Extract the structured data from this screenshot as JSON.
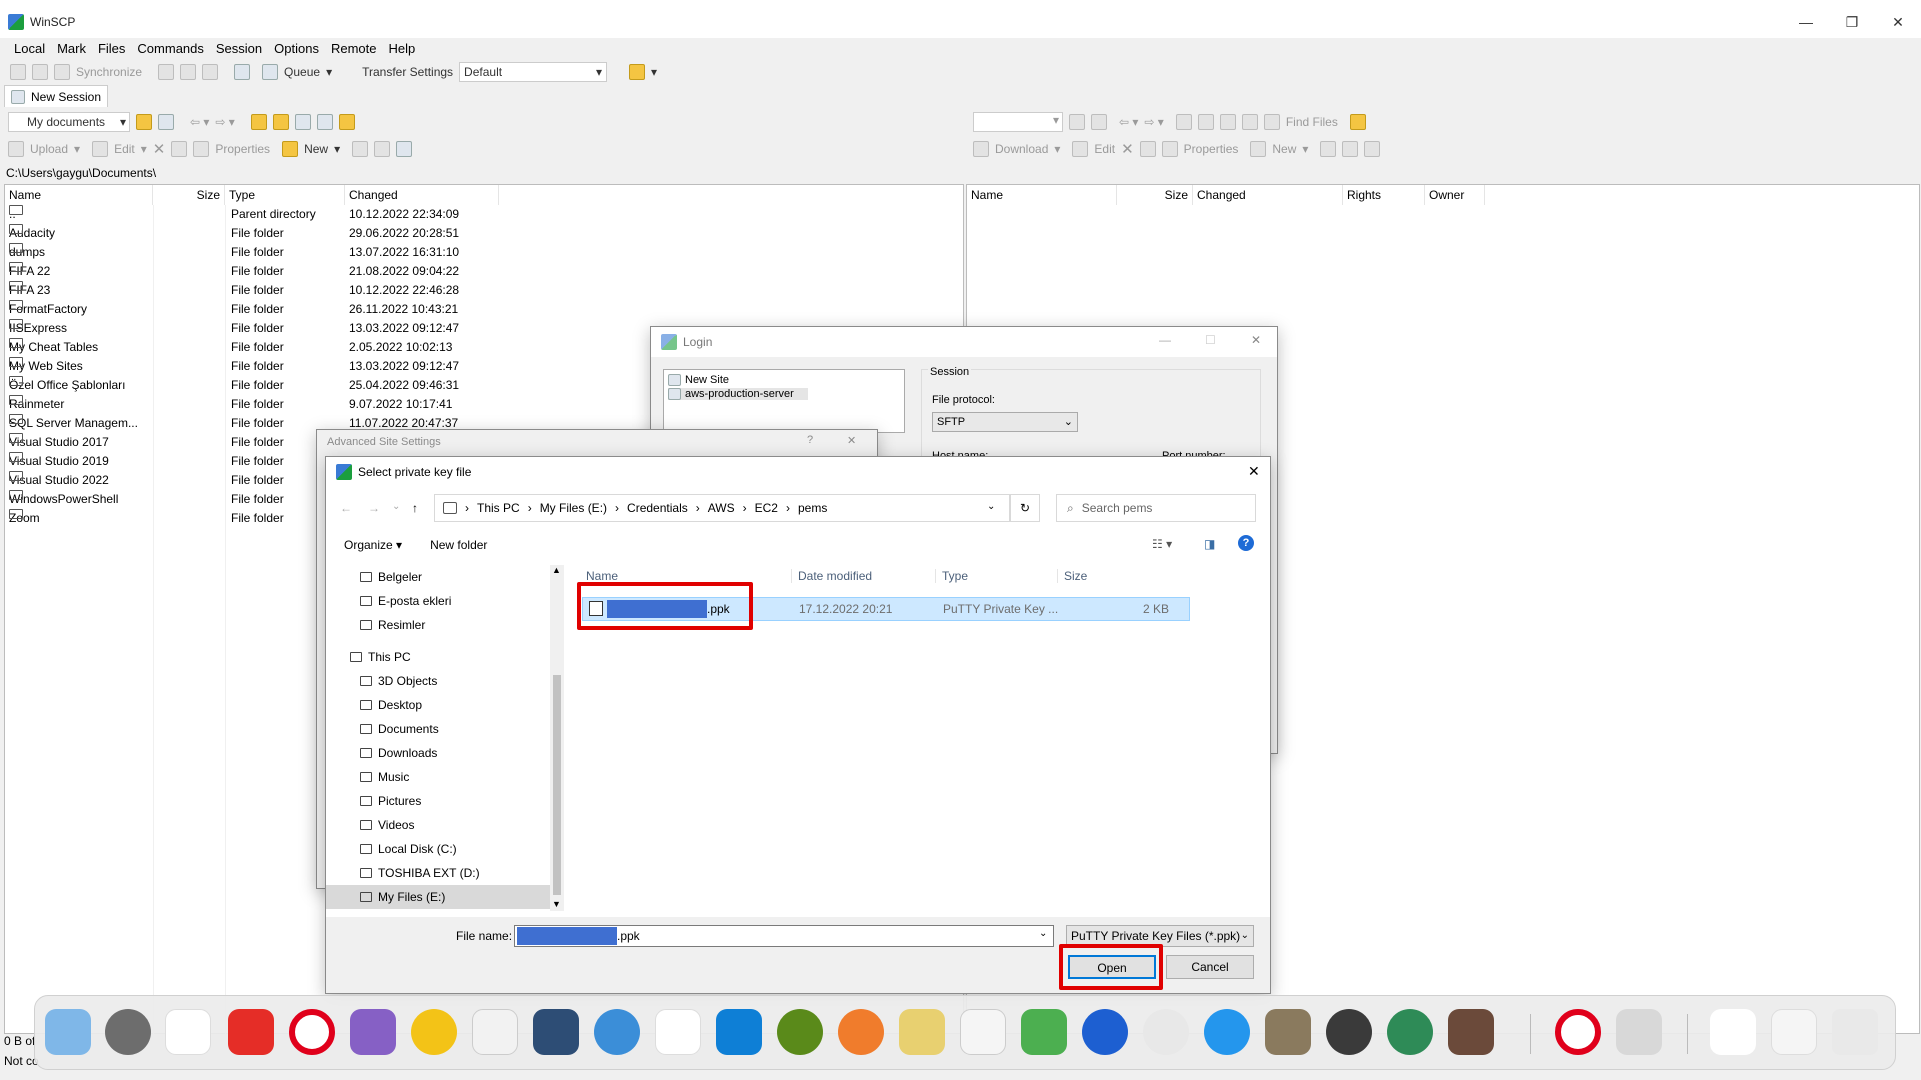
{
  "app_title": "WinSCP",
  "menu": [
    "Local",
    "Mark",
    "Files",
    "Commands",
    "Session",
    "Options",
    "Remote",
    "Help"
  ],
  "toolbar": {
    "synchronize": "Synchronize",
    "queue": "Queue",
    "transfer_settings": "Transfer Settings",
    "transfer_default": "Default"
  },
  "session_tab": "New Session",
  "left_toolbar": {
    "location": "My documents",
    "upload": "Upload",
    "edit": "Edit",
    "properties": "Properties",
    "new": "New"
  },
  "right_toolbar": {
    "find_files": "Find Files",
    "download": "Download",
    "edit": "Edit",
    "properties": "Properties",
    "new": "New"
  },
  "left_path": "C:\\Users\\gaygu\\Documents\\",
  "left_columns": [
    "Name",
    "Size",
    "Type",
    "Changed"
  ],
  "right_columns": [
    "Name",
    "Size",
    "Changed",
    "Rights",
    "Owner"
  ],
  "left_files": [
    {
      "name": "..",
      "type": "Parent directory",
      "changed": "10.12.2022  22:34:09"
    },
    {
      "name": "Audacity",
      "type": "File folder",
      "changed": "29.06.2022  20:28:51"
    },
    {
      "name": "dumps",
      "type": "File folder",
      "changed": "13.07.2022  16:31:10"
    },
    {
      "name": "FIFA 22",
      "type": "File folder",
      "changed": "21.08.2022  09:04:22"
    },
    {
      "name": "FIFA 23",
      "type": "File folder",
      "changed": "10.12.2022  22:46:28"
    },
    {
      "name": "FormatFactory",
      "type": "File folder",
      "changed": "26.11.2022  10:43:21"
    },
    {
      "name": "IISExpress",
      "type": "File folder",
      "changed": "13.03.2022  09:12:47"
    },
    {
      "name": "My Cheat Tables",
      "type": "File folder",
      "changed": "2.05.2022  10:02:13"
    },
    {
      "name": "My Web Sites",
      "type": "File folder",
      "changed": "13.03.2022  09:12:47"
    },
    {
      "name": "Özel Office Şablonları",
      "type": "File folder",
      "changed": "25.04.2022  09:46:31"
    },
    {
      "name": "Rainmeter",
      "type": "File folder",
      "changed": "9.07.2022  10:17:41"
    },
    {
      "name": "SQL Server Managem...",
      "type": "File folder",
      "changed": "11.07.2022  20:47:37"
    },
    {
      "name": "Visual Studio 2017",
      "type": "File folder",
      "changed": ""
    },
    {
      "name": "Visual Studio 2019",
      "type": "File folder",
      "changed": ""
    },
    {
      "name": "Visual Studio 2022",
      "type": "File folder",
      "changed": ""
    },
    {
      "name": "WindowsPowerShell",
      "type": "File folder",
      "changed": ""
    },
    {
      "name": "Zoom",
      "type": "File folder",
      "changed": ""
    }
  ],
  "status_left": "0 B of",
  "status_left2": "Not co",
  "login": {
    "title": "Login",
    "sites": [
      "New Site",
      "aws-production-server"
    ],
    "session_label": "Session",
    "file_protocol_label": "File protocol:",
    "file_protocol": "SFTP",
    "host_label": "Host name:",
    "port_label": "Port number:"
  },
  "advanced": {
    "title": "Advanced Site Settings",
    "help": "?"
  },
  "file_dialog": {
    "title": "Select private key file",
    "breadcrumb": [
      "This PC",
      "My Files (E:)",
      "Credentials",
      "AWS",
      "EC2",
      "pems"
    ],
    "search_placeholder": "Search pems",
    "organize": "Organize",
    "new_folder": "New folder",
    "nav": [
      "Belgeler",
      "E-posta ekleri",
      "Resimler",
      "This PC",
      "3D Objects",
      "Desktop",
      "Documents",
      "Downloads",
      "Music",
      "Pictures",
      "Videos",
      "Local Disk (C:)",
      "TOSHIBA EXT (D:)",
      "My Files (E:)"
    ],
    "columns": [
      "Name",
      "Date modified",
      "Type",
      "Size"
    ],
    "file": {
      "name_suffix": ".ppk",
      "date": "17.12.2022 20:21",
      "type": "PuTTY Private Key ...",
      "size": "2 KB"
    },
    "file_name_label": "File name:",
    "file_name_suffix": ".ppk",
    "filter": "PuTTY Private Key Files (*.ppk)",
    "open": "Open",
    "cancel": "Cancel"
  },
  "highlight_color": "#e00000",
  "selection_color": "#3f6fd1"
}
